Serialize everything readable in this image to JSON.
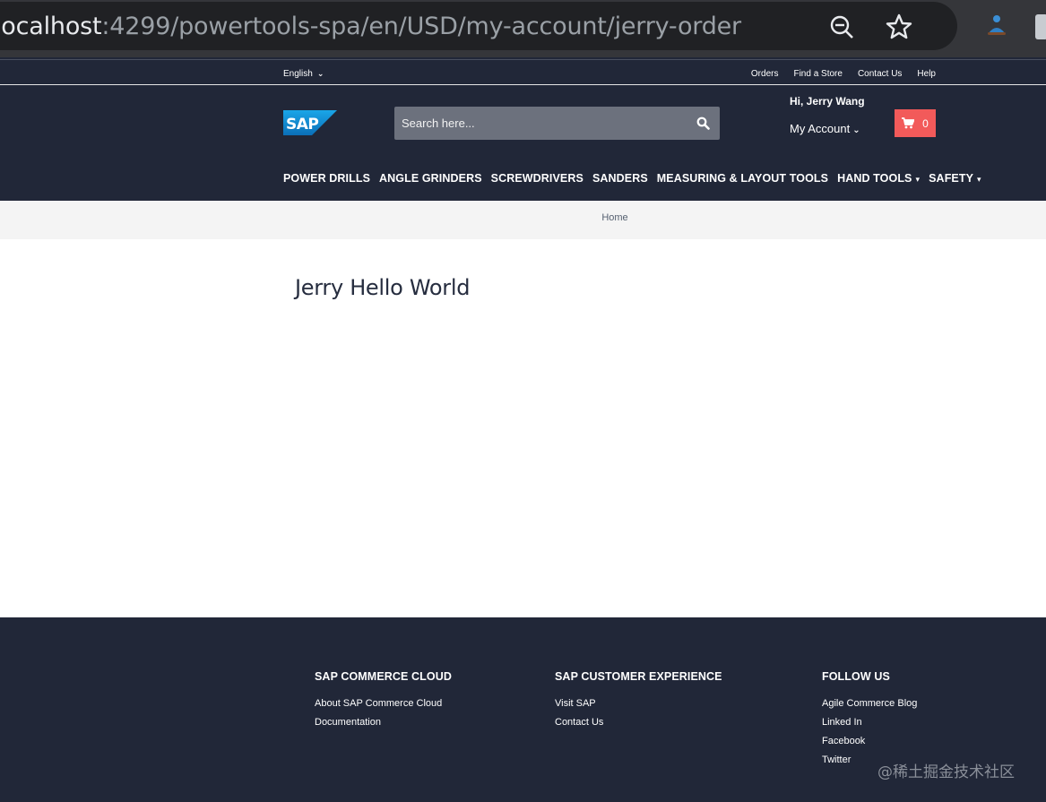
{
  "browser": {
    "url_host": "localhost",
    "url_rest": ":4299/powertools-spa/en/USD/my-account/jerry-order"
  },
  "header": {
    "language": "English",
    "util_links": [
      "Orders",
      "Find a Store",
      "Contact Us",
      "Help"
    ],
    "search_placeholder": "Search here...",
    "greeting": "Hi, Jerry Wang",
    "my_account": "My Account",
    "cart_count": "0",
    "brand_color": "#212738",
    "cart_color": "#f25a5a"
  },
  "nav": {
    "items": [
      {
        "label": "POWER DRILLS",
        "has_menu": false
      },
      {
        "label": "ANGLE GRINDERS",
        "has_menu": false
      },
      {
        "label": "SCREWDRIVERS",
        "has_menu": false
      },
      {
        "label": "SANDERS",
        "has_menu": false
      },
      {
        "label": "MEASURING & LAYOUT TOOLS",
        "has_menu": false
      },
      {
        "label": "HAND TOOLS",
        "has_menu": true
      },
      {
        "label": "SAFETY",
        "has_menu": true
      }
    ]
  },
  "breadcrumb": {
    "home": "Home"
  },
  "main": {
    "title": "Jerry Hello World"
  },
  "footer": {
    "columns": [
      {
        "heading": "SAP COMMERCE CLOUD",
        "links": [
          "About SAP Commerce Cloud",
          "Documentation"
        ]
      },
      {
        "heading": "SAP CUSTOMER EXPERIENCE",
        "links": [
          "Visit SAP",
          "Contact Us"
        ]
      },
      {
        "heading": "FOLLOW US",
        "links": [
          "Agile Commerce Blog",
          "Linked In",
          "Facebook",
          "Twitter"
        ]
      }
    ],
    "watermark": "@稀土掘金技术社区"
  }
}
